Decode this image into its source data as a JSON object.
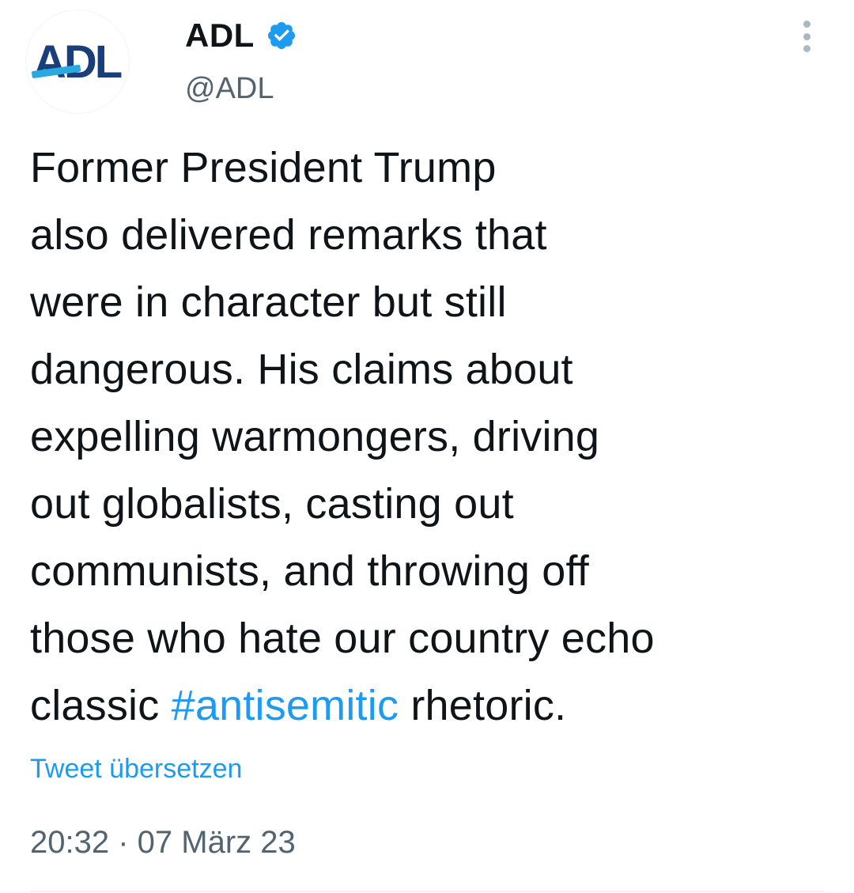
{
  "account": {
    "logo_text": "ADL",
    "display_name": "ADL",
    "verified_icon": "verified-badge-icon",
    "handle": "@ADL"
  },
  "tweet": {
    "lines": [
      "Former President Trump",
      "also delivered remarks that",
      "were in character but still",
      "dangerous. His claims about",
      "expelling warmongers, driving",
      "out globalists, casting out",
      "communists, and throwing off",
      "those who hate our country echo"
    ],
    "last_line_before": "classic ",
    "hashtag": "#antisemitic",
    "last_line_after": " rhetoric."
  },
  "translate_label": "Tweet übersetzen",
  "timestamp": "20:32 · 07 März 23",
  "colors": {
    "accent": "#1d9bf0",
    "text": "#0f1419",
    "secondary": "#536471",
    "logo_blue": "#1f5fa8",
    "logo_dark": "#1a3d7c"
  }
}
